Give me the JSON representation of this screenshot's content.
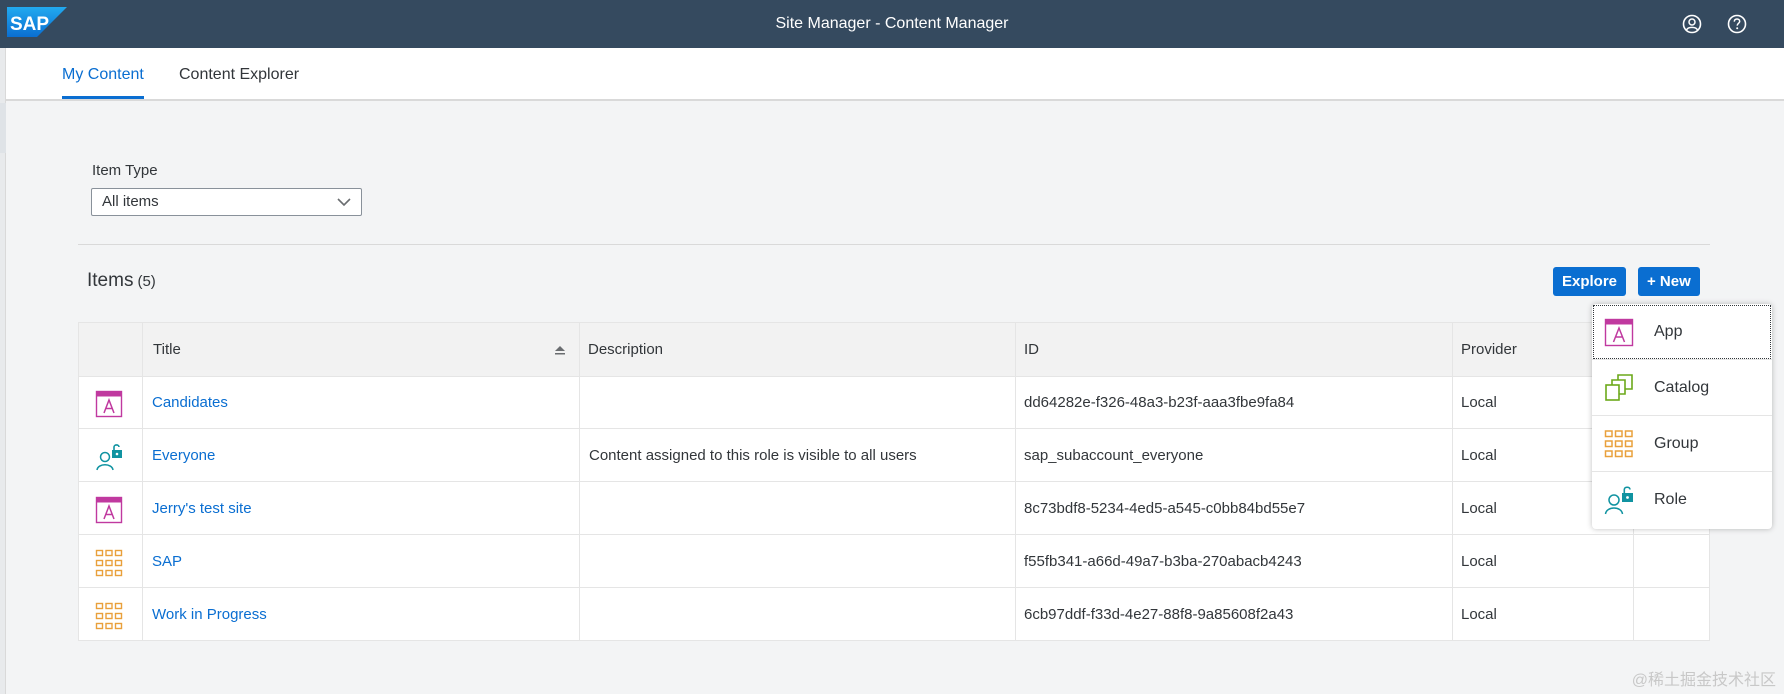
{
  "shell": {
    "logo_text": "SAP",
    "title": "Site Manager - Content Manager",
    "user_icon": "user-icon",
    "help_icon": "help-icon"
  },
  "tabs": [
    {
      "label": "My Content",
      "active": true
    },
    {
      "label": "Content Explorer",
      "active": false
    }
  ],
  "filter": {
    "label": "Item Type",
    "value": "All items"
  },
  "toolbar": {
    "title": "Items",
    "count": "(5)",
    "explore_label": "Explore",
    "new_label": "+ New"
  },
  "table": {
    "columns": [
      "Title",
      "Description",
      "ID",
      "Provider"
    ],
    "rows": [
      {
        "icon": "app-icon",
        "title": "Candidates",
        "description": "",
        "id": "dd64282e-f326-48a3-b23f-aaa3fbe9fa84",
        "provider": "Local"
      },
      {
        "icon": "role-icon",
        "title": "Everyone",
        "description": "Content assigned to this role is visible to all users",
        "id": "sap_subaccount_everyone",
        "provider": "Local"
      },
      {
        "icon": "app-icon",
        "title": "Jerry's test site",
        "description": "",
        "id": "8c73bdf8-5234-4ed5-a545-c0bb84bd55e7",
        "provider": "Local"
      },
      {
        "icon": "group-icon",
        "title": "SAP",
        "description": "",
        "id": "f55fb341-a66d-49a7-b3ba-270abacb4243",
        "provider": "Local"
      },
      {
        "icon": "group-icon",
        "title": "Work in Progress",
        "description": "",
        "id": "6cb97ddf-f33d-4e27-88f8-9a85608f2a43",
        "provider": "Local"
      }
    ]
  },
  "new_menu": {
    "items": [
      {
        "icon": "app-icon",
        "label": "App"
      },
      {
        "icon": "catalog-icon",
        "label": "Catalog"
      },
      {
        "icon": "group-icon",
        "label": "Group"
      },
      {
        "icon": "role-icon",
        "label": "Role"
      }
    ]
  },
  "watermark": "@稀土掘金技术社区",
  "colors": {
    "shell_bg": "#354a5f",
    "accent": "#0a6ed1",
    "app_icon": "#c0399f",
    "role_icon": "#1093a1",
    "group_icon": "#e9a03b",
    "catalog_icon": "#6ca91a"
  }
}
